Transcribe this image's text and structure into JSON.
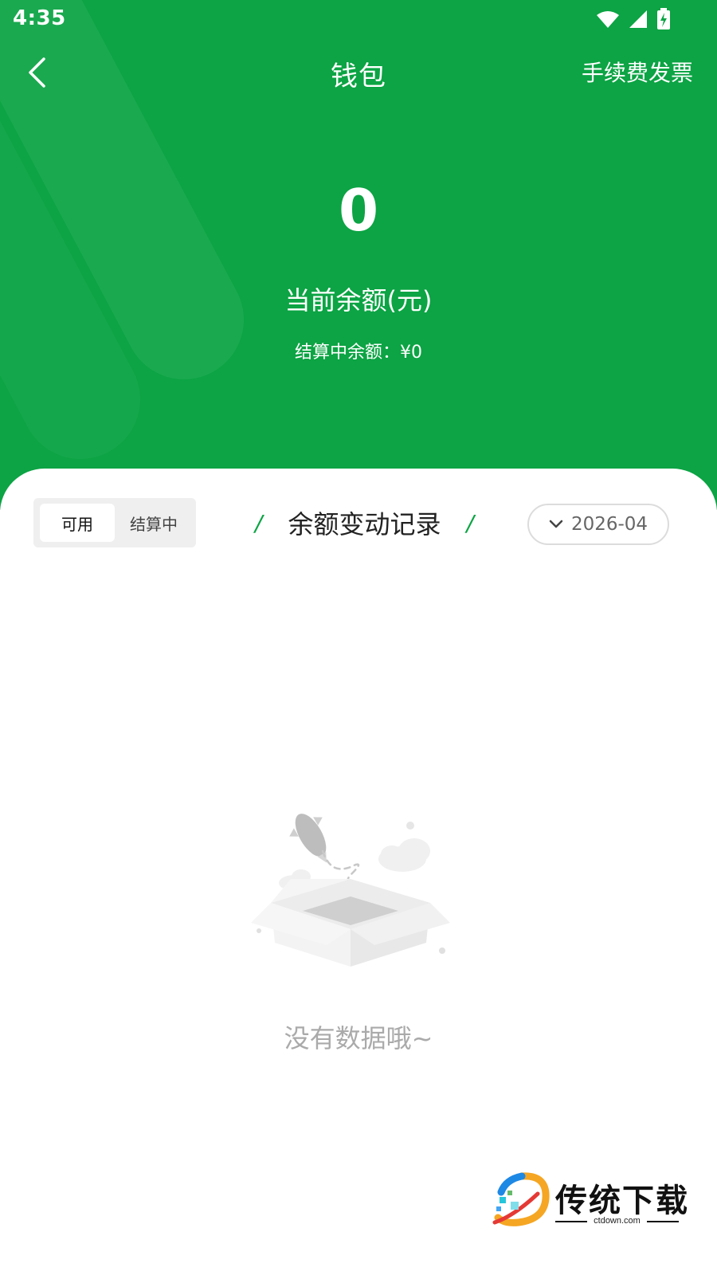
{
  "status_bar": {
    "time": "4:35"
  },
  "nav": {
    "title": "钱包",
    "right_action": "手续费发票"
  },
  "balance": {
    "amount": "0",
    "label": "当前余额(元)",
    "settling_text": "结算中余额：¥0"
  },
  "tabs": [
    {
      "label": "可用",
      "active": true
    },
    {
      "label": "结算中",
      "active": false
    }
  ],
  "records": {
    "title": "余额变动记录",
    "slash": "/"
  },
  "month_picker": {
    "value": "2026-04"
  },
  "empty_state": {
    "text": "没有数据哦~"
  },
  "watermark": {
    "name": "传统下载",
    "site": "ctdown.com"
  },
  "colors": {
    "brand_green": "#0ca444",
    "empty_text": "#aaaaaa"
  }
}
